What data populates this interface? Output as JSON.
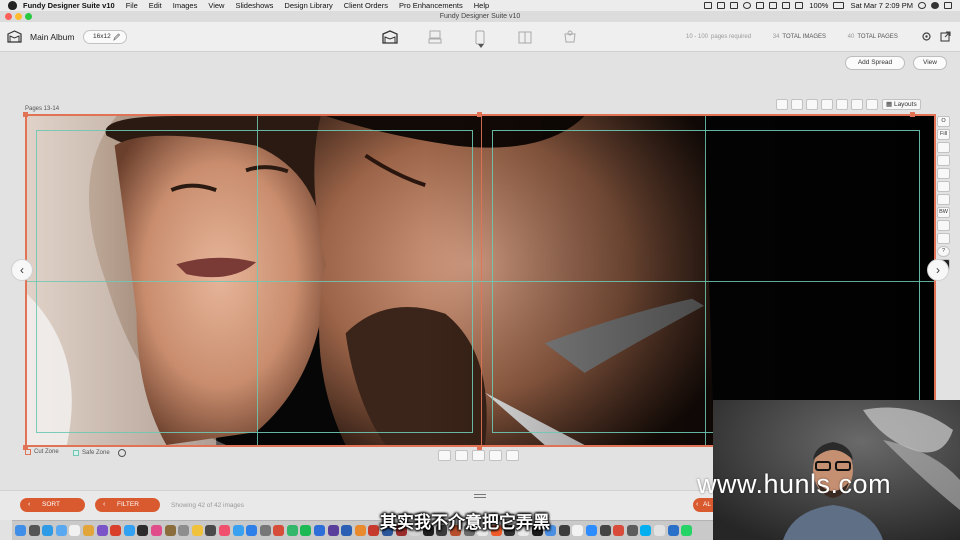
{
  "menubar": {
    "items": [
      "Fundy Designer Suite v10",
      "File",
      "Edit",
      "Images",
      "View",
      "Slideshows",
      "Design Library",
      "Client Orders",
      "Pro Enhancements",
      "Help"
    ],
    "battery": "100%",
    "clock": "Sat Mar 7  2:09 PM"
  },
  "window": {
    "title": "Fundy Designer Suite v10"
  },
  "toolbar": {
    "album_name": "Main Album",
    "album_size": "16x12",
    "mode_icons": [
      "album-designer-icon",
      "wall-art-icon",
      "phone-icon",
      "gallery-icon",
      "cart-icon"
    ],
    "stats": [
      {
        "num": "10 - 100",
        "label": "pages required",
        "dim": true
      },
      {
        "num": "34",
        "label": "TOTAL IMAGES",
        "dim": false
      },
      {
        "num": "40",
        "label": "TOTAL PAGES",
        "dim": false
      }
    ]
  },
  "actions": {
    "add_spread": "Add Spread",
    "view": "View"
  },
  "spread": {
    "pages_label": "Pages 13-14",
    "layouts_label": "Layouts",
    "side_tools": [
      "O",
      "Fill",
      "",
      "",
      "",
      "",
      "",
      "BW",
      "",
      "",
      "?",
      "×"
    ],
    "cut_zone": "Cut Zone",
    "safe_zone": "Safe Zone"
  },
  "lowerbar": {
    "sort": "SORT",
    "filter": "FILTER",
    "showing": "Showing 42 of 42 images",
    "right_btn": "AL"
  },
  "overlay": {
    "watermark": "www.hunls.com",
    "subtitle": "其实我不介意把它弄黑"
  },
  "colors": {
    "accent": "#d95a2f",
    "cut_zone": "#e07356",
    "safe_zone": "#6ec8b4"
  }
}
